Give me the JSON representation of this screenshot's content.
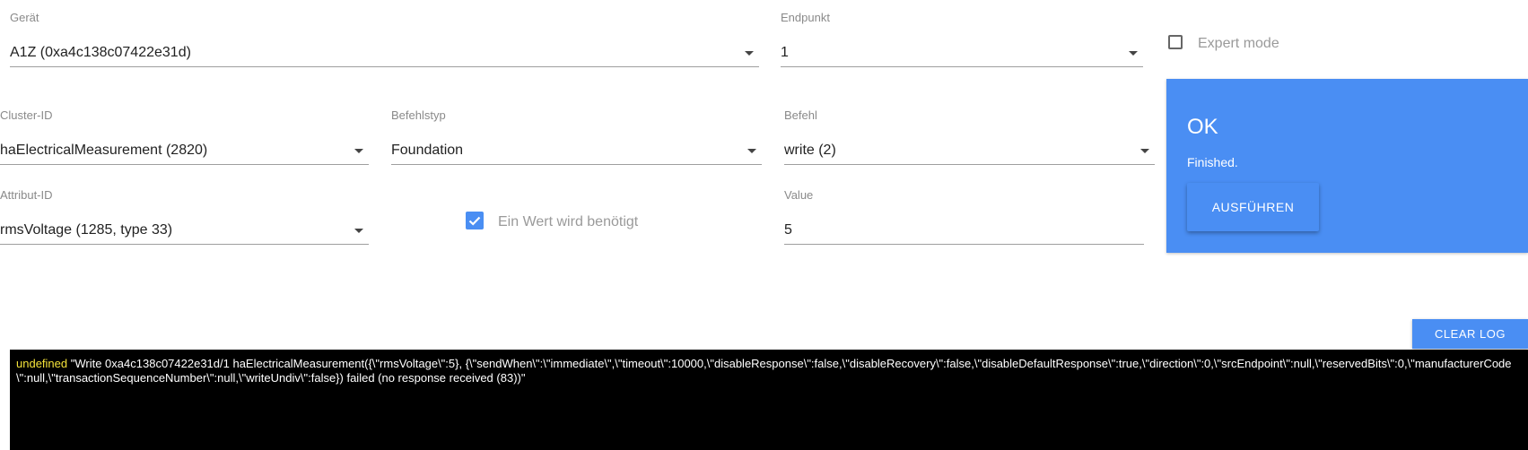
{
  "device": {
    "label": "Gerät",
    "value": "A1Z (0xa4c138c07422e31d)"
  },
  "endpoint": {
    "label": "Endpunkt",
    "value": "1"
  },
  "expert_mode": {
    "label": "Expert mode",
    "checked": false
  },
  "cluster": {
    "label": "Cluster-ID",
    "value": "haElectricalMeasurement (2820)"
  },
  "command_type": {
    "label": "Befehlstyp",
    "value": "Foundation"
  },
  "command": {
    "label": "Befehl",
    "value": "write (2)"
  },
  "attribute": {
    "label": "Attribut-ID",
    "value": "rmsVoltage (1285, type 33)"
  },
  "value_required": {
    "label": "Ein Wert wird benötigt",
    "checked": true
  },
  "value_field": {
    "label": "Value",
    "value": "5"
  },
  "result_panel": {
    "title": "OK",
    "status": "Finished.",
    "run_label": "AUSFÜHREN",
    "color": "#4a8ef3"
  },
  "log": {
    "clear_label": "CLEAR LOG",
    "entry_prefix": "undefined",
    "entry_text": " \"Write 0xa4c138c07422e31d/1 haElectricalMeasurement({\\\"rmsVoltage\\\":5}, {\\\"sendWhen\\\":\\\"immediate\\\",\\\"timeout\\\":10000,\\\"disableResponse\\\":false,\\\"disableRecovery\\\":false,\\\"disableDefaultResponse\\\":true,\\\"direction\\\":0,\\\"srcEndpoint\\\":null,\\\"reservedBits\\\":0,\\\"manufacturerCode\\\":null,\\\"transactionSequenceNumber\\\":null,\\\"writeUndiv\\\":false}) failed (no response received (83))\""
  }
}
